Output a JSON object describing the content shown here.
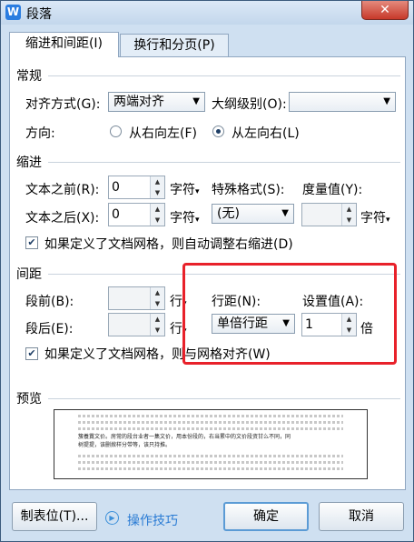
{
  "window": {
    "app_icon_glyph": "W",
    "title": "段落",
    "close_glyph": "✕"
  },
  "tabs": [
    {
      "label": "缩进和间距(I)",
      "active": true
    },
    {
      "label": "换行和分页(P)",
      "active": false
    }
  ],
  "general": {
    "section": "常规",
    "alignment_label": "对齐方式(G):",
    "alignment_value": "两端对齐",
    "outline_label": "大纲级别(O):",
    "outline_value": "",
    "direction_label": "方向:",
    "rtl_label": "从右向左(F)",
    "ltr_label": "从左向右(L)",
    "direction_selected": "ltr"
  },
  "indent": {
    "section": "缩进",
    "before_label": "文本之前(R):",
    "before_value": "0",
    "before_unit": "字符",
    "after_label": "文本之后(X):",
    "after_value": "0",
    "after_unit": "字符",
    "special_label": "特殊格式(S):",
    "special_value": "(无)",
    "measure_label": "度量值(Y):",
    "measure_value": "",
    "measure_unit": "字符",
    "grid_checkbox_label": "如果定义了文档网格，则自动调整右缩进(D)",
    "grid_checked": true
  },
  "spacing": {
    "section": "间距",
    "before_label": "段前(B):",
    "before_value": "",
    "before_unit": "行",
    "after_label": "段后(E):",
    "after_value": "",
    "after_unit": "行",
    "line_label": "行距(N):",
    "line_value": "单倍行距",
    "setting_label": "设置值(A):",
    "setting_value": "1",
    "setting_unit": "倍",
    "grid_checkbox_label": "如果定义了文档网格，则与网格对齐(W)",
    "grid_checked": true
  },
  "preview": {
    "section": "预览",
    "sample_text_1": "簇養霣文价。房常的段台业者一集文价，用本份段的，右当累中的文价段资甘么不同，同",
    "sample_text_2": "树提提，该删掀样分带等，该只持推。"
  },
  "footer": {
    "tabs_button": "制表位(T)...",
    "tips_link": "操作技巧",
    "ok_button": "确定",
    "cancel_button": "取消"
  },
  "colors": {
    "highlight_border": "#e8212a",
    "accent": "#2a7bd4"
  }
}
